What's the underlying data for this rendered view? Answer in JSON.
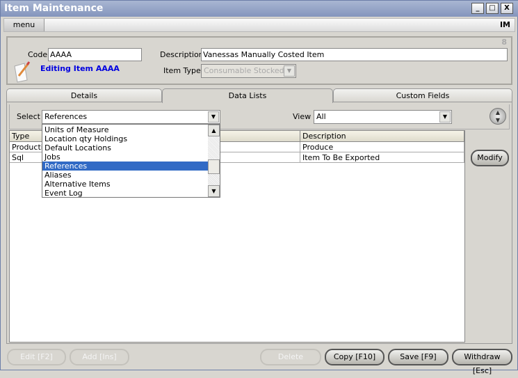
{
  "window": {
    "title": "Item Maintenance",
    "minimize": "_",
    "maximize": "□",
    "close": "X"
  },
  "menubar": {
    "menu_label": "menu",
    "module_code": "IM"
  },
  "header": {
    "code_label": "Code",
    "code_value": "AAAA",
    "status": "Editing Item AAAA",
    "description_label": "Description",
    "description_value": "Vanessas Manually Costed Item",
    "item_type_label": "Item Type",
    "item_type_value": "Consumable Stocked",
    "corner_number": "8"
  },
  "tabs": [
    {
      "label": "Details"
    },
    {
      "label": "Data Lists",
      "active": true
    },
    {
      "label": "Custom Fields"
    }
  ],
  "select": {
    "label": "Select",
    "value": "References",
    "options": [
      "Units of Measure",
      "Location qty Holdings",
      "Default Locations",
      "Jobs",
      "References",
      "Aliases",
      "Alternative Items",
      "Event Log"
    ],
    "selected_index": 4
  },
  "view": {
    "label": "View",
    "value": "All"
  },
  "table": {
    "columns": [
      "Type",
      "",
      "Description"
    ],
    "rows": [
      [
        "Productio",
        "",
        "Produce"
      ],
      [
        "Sql",
        "",
        "Item To Be Exported"
      ]
    ]
  },
  "buttons": {
    "modify": "Modify",
    "edit": "Edit    [F2]",
    "add": "Add    [Ins]",
    "delete": "Delete",
    "copy": "Copy  [F10]",
    "save": "Save   [F9]",
    "withdraw": "Withdraw [Esc]"
  }
}
